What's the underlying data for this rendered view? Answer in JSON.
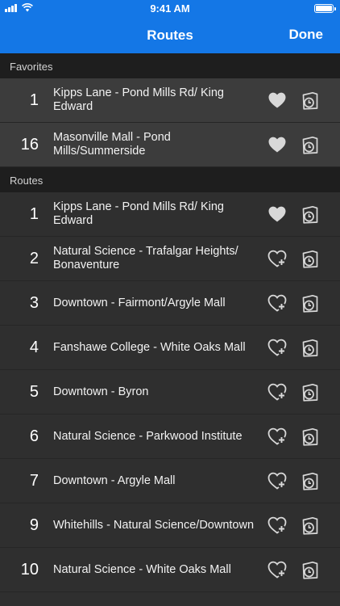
{
  "status": {
    "time": "9:41 AM"
  },
  "nav": {
    "title": "Routes",
    "done_label": "Done"
  },
  "favorites": {
    "header": "Favorites",
    "items": [
      {
        "number": "1",
        "name": "Kipps Lane - Pond Mills Rd/ King Edward",
        "favorited": true
      },
      {
        "number": "16",
        "name": "Masonville Mall - Pond Mills/Summerside",
        "favorited": true
      }
    ]
  },
  "routes": {
    "header": "Routes",
    "items": [
      {
        "number": "1",
        "name": "Kipps Lane - Pond Mills Rd/ King Edward",
        "favorited": true
      },
      {
        "number": "2",
        "name": "Natural Science - Trafalgar Heights/ Bonaventure",
        "favorited": false
      },
      {
        "number": "3",
        "name": "Downtown - Fairmont/Argyle Mall",
        "favorited": false
      },
      {
        "number": "4",
        "name": "Fanshawe College - White Oaks Mall",
        "favorited": false
      },
      {
        "number": "5",
        "name": "Downtown - Byron",
        "favorited": false
      },
      {
        "number": "6",
        "name": "Natural Science - Parkwood Institute",
        "favorited": false
      },
      {
        "number": "7",
        "name": "Downtown - Argyle Mall",
        "favorited": false
      },
      {
        "number": "9",
        "name": "Whitehills - Natural Science/Downtown",
        "favorited": false
      },
      {
        "number": "10",
        "name": "Natural Science - White Oaks Mall",
        "favorited": false
      }
    ]
  },
  "colors": {
    "nav_blue": "#1477e6",
    "favorite_row": "#3c3c3c",
    "route_row": "#2f2f2f",
    "section_header": "#1e1e1e",
    "icon": "#d8d8d8"
  },
  "icons": {
    "filled_heart": "heart-filled-icon",
    "add_heart": "heart-add-icon",
    "schedule": "schedule-clock-icon"
  }
}
